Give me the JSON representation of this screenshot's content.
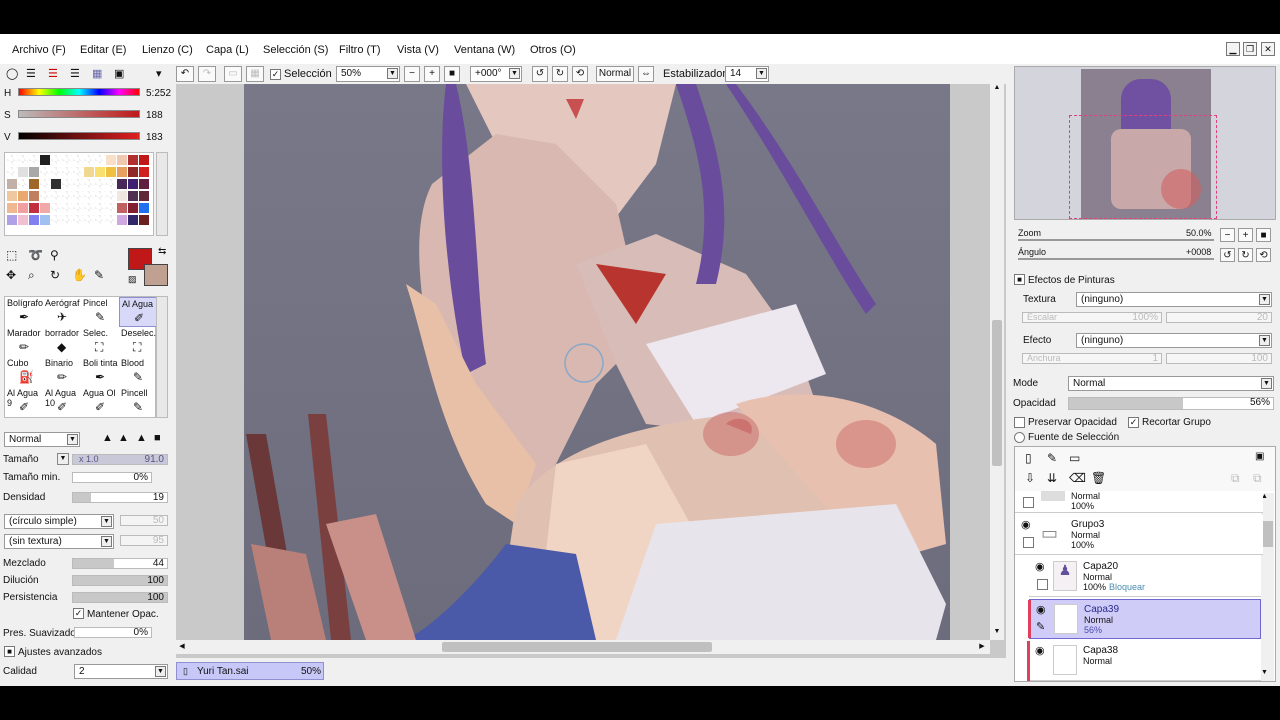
{
  "menu": [
    "Archivo (F)",
    "Editar (E)",
    "Lienzo (C)",
    "Capa (L)",
    "Selección (S)",
    "Filtro (T)",
    "Vista (V)",
    "Ventana (W)",
    "Otros (O)"
  ],
  "toolbar": {
    "seleccion_label": "Selección",
    "zoom": "50%",
    "angle": "+000°",
    "blend": "Normal",
    "estabilizador_label": "Estabilizador",
    "estabilizador_value": "14"
  },
  "color": {
    "h_label": "H",
    "h_value": "5:252",
    "s_label": "S",
    "s_value": "188",
    "v_label": "V",
    "v_value": "183",
    "primary": "#c01818",
    "secondary": "#c0a090"
  },
  "brushes": [
    {
      "name": "Bolígrafo",
      "icon": "pen-icon"
    },
    {
      "name": "Aerógraf",
      "icon": "airbrush-icon"
    },
    {
      "name": "Pincel",
      "icon": "brush-icon"
    },
    {
      "name": "Al Agua",
      "icon": "watercolor-icon"
    },
    {
      "name": "Marador",
      "icon": "marker-icon"
    },
    {
      "name": "borrador",
      "icon": "eraser-icon"
    },
    {
      "name": "Selec.",
      "icon": "select-icon"
    },
    {
      "name": "Deselec.",
      "icon": "deselect-icon"
    },
    {
      "name": "Cubo",
      "icon": "bucket-icon"
    },
    {
      "name": "Binario",
      "icon": "binary-icon"
    },
    {
      "name": "Boli tinta",
      "icon": "ink-pen-icon"
    },
    {
      "name": "Blood",
      "icon": "blood-icon"
    },
    {
      "name": "Al Agua 9",
      "icon": "watercolor-icon"
    },
    {
      "name": "Al Agua 10",
      "icon": "watercolor-icon"
    },
    {
      "name": "Agua Ol",
      "icon": "oil-icon"
    },
    {
      "name": "Pincell",
      "icon": "brush-icon"
    }
  ],
  "brush": {
    "blend": "Normal",
    "tamano_label": "Tamaño",
    "tamano_mult": "x 1.0",
    "tamano_value": "91.0",
    "tamano_min_label": "Tamaño min.",
    "tamano_min_value": "0%",
    "densidad_label": "Densidad",
    "densidad_value": "19",
    "densidad_frac": 0.19,
    "shape": "(círculo simple)",
    "shape_value": "50",
    "texture": "(sin textura)",
    "texture_value": "95",
    "mezclado_label": "Mezclado",
    "mezclado_value": "44",
    "mezclado_frac": 0.44,
    "dilucion_label": "Dilución",
    "dilucion_value": "100",
    "dilucion_frac": 1.0,
    "persistencia_label": "Persistencia",
    "persistencia_value": "100",
    "persistencia_frac": 1.0,
    "mantener_label": "Mantener Opac.",
    "suavizado_label": "Pres. Suavizado",
    "suavizado_value": "0%",
    "avanzados_label": "Ajustes avanzados",
    "calidad_label": "Calidad",
    "calidad_value": "2"
  },
  "navigator": {
    "zoom_label": "Zoom",
    "zoom_value": "50.0%",
    "angulo_label": "Ángulo",
    "angulo_value": "+0008"
  },
  "effects": {
    "title": "Efectos de Pinturas",
    "textura_label": "Textura",
    "textura_value": "(ninguno)",
    "escalar_label": "Escalar",
    "escalar_value": "100%",
    "escalar_num": "20",
    "efecto_label": "Efecto",
    "efecto_value": "(ninguno)",
    "anchura_label": "Anchura",
    "anchura_value": "1",
    "anchura_num": "100"
  },
  "layer_props": {
    "mode_label": "Mode",
    "mode_value": "Normal",
    "opacidad_label": "Opacidad",
    "opacidad_value": "56%",
    "opacidad_frac": 0.56,
    "preservar_label": "Preservar Opacidad",
    "recortar_label": "Recortar Grupo",
    "fuente_label": "Fuente de Selección"
  },
  "layers": [
    {
      "name": "",
      "mode": "Normal",
      "opacity": "100%",
      "extra": ""
    },
    {
      "name": "Grupo3",
      "mode": "Normal",
      "opacity": "100%",
      "extra": ""
    },
    {
      "name": "Capa20",
      "mode": "Normal",
      "opacity": "100%",
      "extra": "Bloquear"
    },
    {
      "name": "Capa39",
      "mode": "Normal",
      "opacity": "56%",
      "extra": ""
    },
    {
      "name": "Capa38",
      "mode": "Normal",
      "opacity": "",
      "extra": ""
    }
  ],
  "status": {
    "file": "Yuri Tan.sai",
    "zoom": "50%"
  }
}
